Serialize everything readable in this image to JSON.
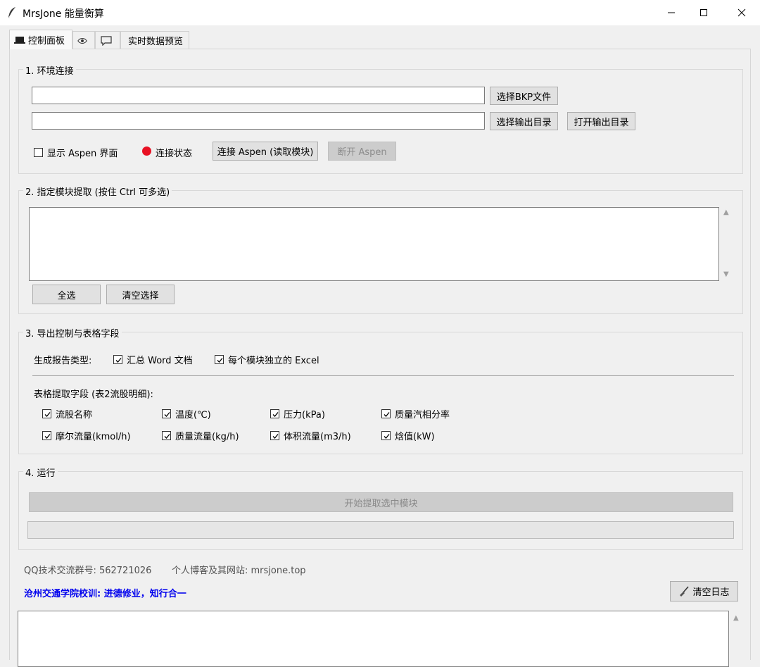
{
  "window": {
    "title": "MrsJone 能量衡算",
    "icon": "feather-icon"
  },
  "tabs": [
    {
      "label": "控制面板",
      "icon": "laptop-icon",
      "active": true
    },
    {
      "label": "",
      "icon": "eye-icon"
    },
    {
      "label": "",
      "icon": "chat-bubble-icon"
    },
    {
      "label": "实时数据预览"
    }
  ],
  "section1": {
    "title": "1. 环境连接",
    "bkp_path": "",
    "output_path": "",
    "select_bkp_label": "选择BKP文件",
    "select_output_label": "选择输出目录",
    "open_output_label": "打开输出目录",
    "show_aspen_label": "显示 Aspen 界面",
    "show_aspen_checked": false,
    "status_label": "连接状态",
    "status_color": "#e81123",
    "connect_label": "连接 Aspen (读取模块)",
    "disconnect_label": "断开 Aspen"
  },
  "section2": {
    "title": "2. 指定模块提取 (按住 Ctrl 可多选)",
    "items": [],
    "select_all_label": "全选",
    "clear_label": "清空选择"
  },
  "section3": {
    "title": "3. 导出控制与表格字段",
    "report_type_label": "生成报告类型:",
    "report_options": [
      {
        "label": "汇总 Word 文档",
        "checked": true
      },
      {
        "label": "每个模块独立的 Excel",
        "checked": true
      }
    ],
    "fields_label": "表格提取字段 (表2流股明细):",
    "fields": [
      {
        "label": "流股名称",
        "checked": true
      },
      {
        "label": "温度(℃)",
        "checked": true
      },
      {
        "label": "压力(kPa)",
        "checked": true
      },
      {
        "label": "质量汽相分率",
        "checked": true
      },
      {
        "label": "摩尔流量(kmol/h)",
        "checked": true
      },
      {
        "label": "质量流量(kg/h)",
        "checked": true
      },
      {
        "label": "体积流量(m3/h)",
        "checked": true
      },
      {
        "label": "焓值(kW)",
        "checked": true
      }
    ]
  },
  "section4": {
    "title": "4. 运行",
    "start_label": "开始提取选中模块",
    "progress": 0
  },
  "footer": {
    "qq_group": "QQ技术交流群号: 562721026",
    "website": "个人博客及其网站: mrsjone.top",
    "motto": "沧州交通学院校训: 进德修业，知行合一",
    "clear_log_label": "清空日志"
  },
  "colors": {
    "motto": "#0000ee",
    "status": "#e81123"
  }
}
